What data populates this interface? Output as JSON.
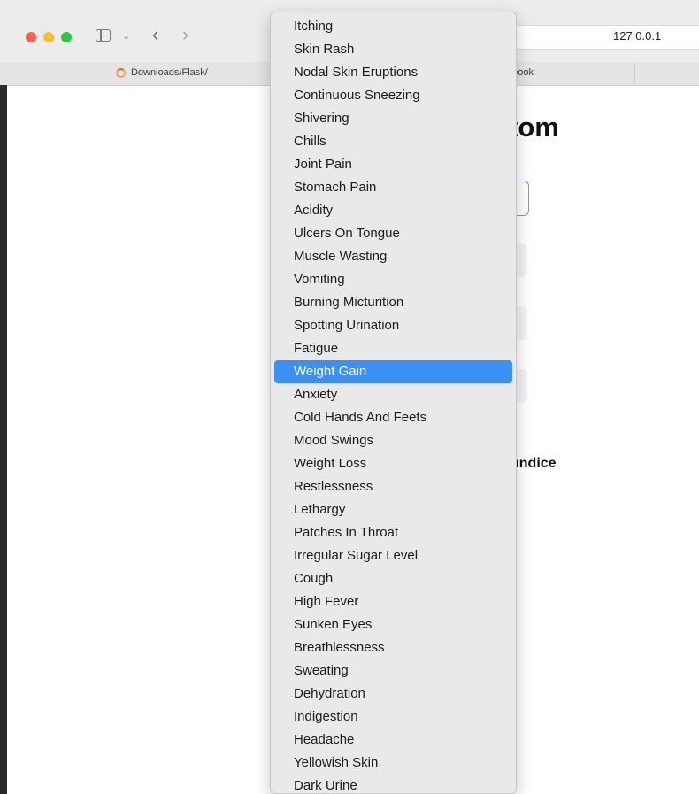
{
  "browser": {
    "address": "127.0.0.1",
    "tabs": [
      {
        "label": "Downloads/Flask/"
      },
      {
        "label": "ebook"
      }
    ]
  },
  "page": {
    "heading_fragment": "tom",
    "result_fragment": "undice"
  },
  "dropdown": {
    "selected_index": 15,
    "options": [
      "Itching",
      "Skin Rash",
      "Nodal Skin Eruptions",
      "Continuous Sneezing",
      "Shivering",
      "Chills",
      "Joint Pain",
      "Stomach Pain",
      "Acidity",
      "Ulcers On Tongue",
      "Muscle Wasting",
      "Vomiting",
      "Burning Micturition",
      "Spotting Urination",
      "Fatigue",
      "Weight Gain",
      "Anxiety",
      "Cold Hands And Feets",
      "Mood Swings",
      "Weight Loss",
      "Restlessness",
      "Lethargy",
      "Patches In Throat",
      "Irregular Sugar Level",
      "Cough",
      "High Fever",
      "Sunken Eyes",
      "Breathlessness",
      "Sweating",
      "Dehydration",
      "Indigestion",
      "Headache",
      "Yellowish Skin",
      "Dark Urine"
    ]
  },
  "colors": {
    "selection": "#3b8ff5",
    "focus_ring": "#6d9fd4"
  }
}
